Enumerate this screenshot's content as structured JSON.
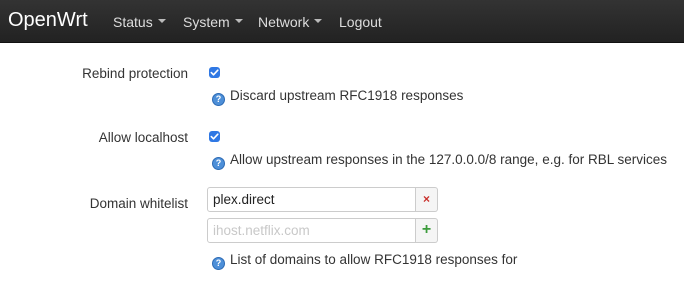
{
  "navbar": {
    "brand": "OpenWrt",
    "items": [
      {
        "label": "Status",
        "dropdown": true
      },
      {
        "label": "System",
        "dropdown": true
      },
      {
        "label": "Network",
        "dropdown": true
      },
      {
        "label": "Logout",
        "dropdown": false
      }
    ]
  },
  "form": {
    "rebind": {
      "label": "Rebind protection",
      "checked": true,
      "help": "Discard upstream RFC1918 responses"
    },
    "localhost": {
      "label": "Allow localhost",
      "checked": true,
      "help": "Allow upstream responses in the 127.0.0.0/8 range, e.g. for RBL services"
    },
    "whitelist": {
      "label": "Domain whitelist",
      "entries": [
        "plex.direct"
      ],
      "new_entry_placeholder": "ihost.netflix.com",
      "remove_symbol": "×",
      "add_symbol": "+",
      "help": "List of domains to allow RFC1918 responses for"
    }
  },
  "icons": {
    "help": "help-circle-icon",
    "checkbox": "checkmark-icon"
  },
  "colors": {
    "navbar": "#222222",
    "checkbox": "#2f78e4",
    "help_icon": "#4d8fd8",
    "remove": "#c9302c",
    "add": "#3c9c3c"
  }
}
